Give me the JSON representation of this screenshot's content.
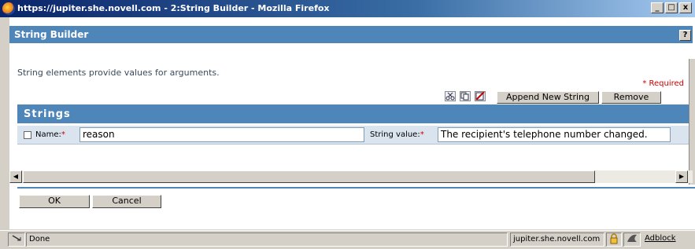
{
  "window": {
    "title": "https://jupiter.she.novell.com - 2:String Builder - Mozilla Firefox",
    "minimize": "_",
    "restore": "□",
    "close": "x"
  },
  "header": {
    "title": "String Builder",
    "help": "?"
  },
  "description": "String elements provide values for arguments.",
  "required_note": "* Required",
  "toolbar": {
    "append_label": "Append New String",
    "remove_label": "Remove"
  },
  "panel": {
    "title": "Strings"
  },
  "row": {
    "name_label": "Name:",
    "name_value": "reason",
    "string_label": "String value:",
    "string_value": "The recipient's telephone number changed."
  },
  "actions": {
    "ok_label": "OK",
    "cancel_label": "Cancel"
  },
  "statusbar": {
    "status_text": "Done",
    "host": "jupiter.she.novell.com",
    "adblock": "Adblock"
  },
  "colors": {
    "header": "#4f86b9",
    "titlebar": "#0a246a",
    "required": "#cc0000"
  }
}
